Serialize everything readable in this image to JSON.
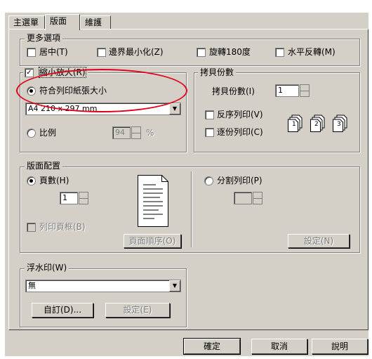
{
  "tabs": [
    {
      "label": "主選單"
    },
    {
      "label": "版面"
    },
    {
      "label": "維護"
    }
  ],
  "more_options": {
    "title": "更多選項",
    "center": {
      "label": "居中(T)",
      "checked": false
    },
    "min_margin": {
      "label": "邊界最小化(Z)",
      "checked": false
    },
    "rotate180": {
      "label": "旋轉180度",
      "checked": false
    },
    "mirror": {
      "label": "水平反轉(M)",
      "checked": false
    }
  },
  "scale": {
    "reduce_enlarge": {
      "label": "縮小放大(R)",
      "checked": true
    },
    "fit_to_page": {
      "label": "符合列印紙張大小",
      "selected": true
    },
    "paper_size": "A4 210 x 297 mm",
    "ratio": {
      "label": "比例",
      "value": "94",
      "unit": "%"
    }
  },
  "copies": {
    "title": "拷貝份數",
    "label": "拷貝份數(I)",
    "value": "1",
    "reverse": {
      "label": "反序列印(V)",
      "checked": false
    },
    "collate": {
      "label": "逐份列印(C)",
      "checked": false
    },
    "collate_icons": [
      "1",
      "2",
      "3"
    ]
  },
  "layout": {
    "title": "版面配置",
    "pages": {
      "label": "頁數(H)",
      "selected": true,
      "value": "1"
    },
    "print_border": {
      "label": "列印頁框(B)"
    },
    "page_order_button": "頁面順序(O)",
    "split": {
      "label": "分割列印(P)",
      "selected": false
    },
    "split_settings_button": "設定(N)"
  },
  "watermark": {
    "title": "浮水印(W)",
    "value": "無",
    "custom_button": "自訂(D)...",
    "settings_button": "設定(E)"
  },
  "footer": {
    "ok": "確定",
    "cancel": "取消",
    "help": "說明"
  }
}
